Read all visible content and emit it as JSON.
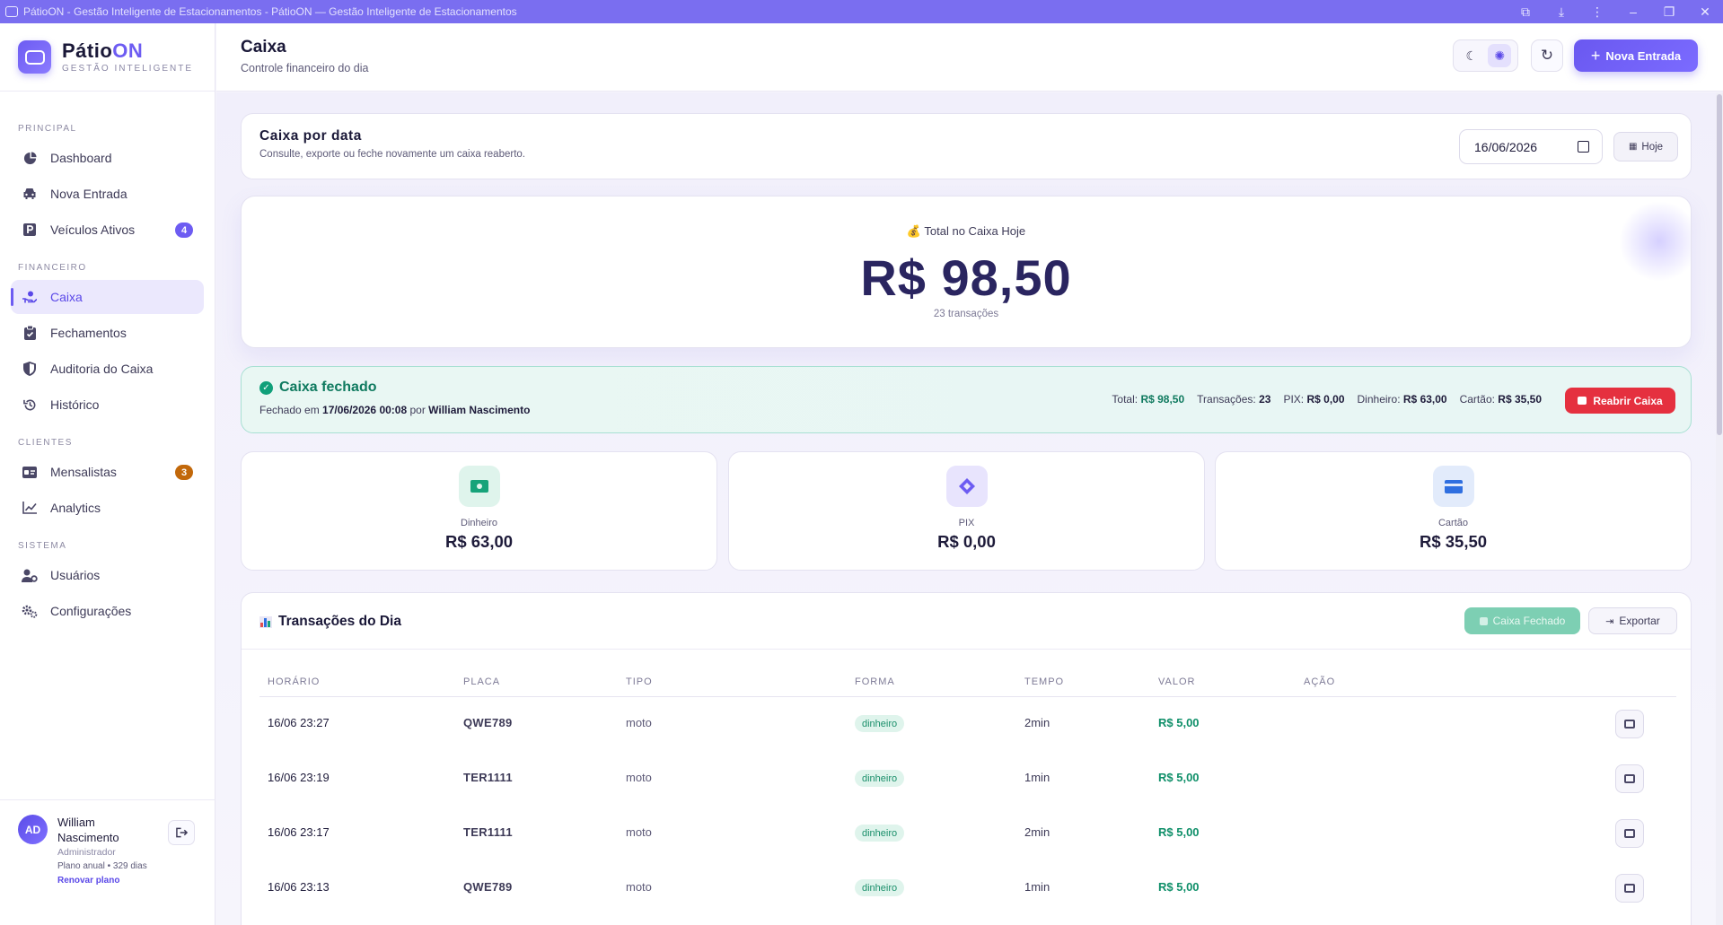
{
  "window": {
    "title": "PátioON - Gestão Inteligente de Estacionamentos - PátioON — Gestão Inteligente de Estacionamentos"
  },
  "brand": {
    "name_a": "Pátio",
    "name_b": "ON",
    "tagline": "GESTÃO INTELIGENTE"
  },
  "sidebar": {
    "sections": [
      "PRINCIPAL",
      "FINANCEIRO",
      "CLIENTES",
      "SISTEMA"
    ],
    "items": [
      {
        "label": "Dashboard",
        "icon": "dashboard-icon"
      },
      {
        "label": "Nova Entrada",
        "icon": "car-icon"
      },
      {
        "label": "Veículos Ativos",
        "icon": "parking-icon",
        "badge": "4"
      },
      {
        "label": "Caixa",
        "icon": "cash-hand-icon",
        "active": true
      },
      {
        "label": "Fechamentos",
        "icon": "clipboard-icon"
      },
      {
        "label": "Auditoria do Caixa",
        "icon": "shield-icon"
      },
      {
        "label": "Histórico",
        "icon": "history-icon"
      },
      {
        "label": "Mensalistas",
        "icon": "id-card-icon",
        "badge": "3"
      },
      {
        "label": "Analytics",
        "icon": "chart-line-icon"
      },
      {
        "label": "Usuários",
        "icon": "user-gear-icon"
      },
      {
        "label": "Configurações",
        "icon": "gears-icon"
      }
    ],
    "user": {
      "initials": "AD",
      "name": "William Nascimento",
      "role": "Administrador",
      "plan": "Plano anual • 329 dias",
      "renew": "Renovar plano"
    }
  },
  "header": {
    "title": "Caixa",
    "subtitle": "Controle financeiro do dia",
    "new_entry": "Nova Entrada"
  },
  "date_panel": {
    "title": "Caixa por data",
    "subtitle": "Consulte, exporte ou feche novamente um caixa reaberto.",
    "date_value": "16/06/2026",
    "today_label": "Hoje"
  },
  "total": {
    "label": "💰 Total no Caixa Hoje",
    "value": "R$ 98,50",
    "count": "23 transações"
  },
  "closed": {
    "title": "Caixa fechado",
    "closed_prefix": "Fechado em",
    "closed_at": "17/06/2026 00:08",
    "by_prefix": "por",
    "by": "William Nascimento",
    "stats": {
      "total_k": "Total:",
      "total_v": "R$ 98,50",
      "tx_k": "Transações:",
      "tx_v": "23",
      "pix_k": "PIX:",
      "pix_v": "R$ 0,00",
      "cash_k": "Dinheiro:",
      "cash_v": "R$ 63,00",
      "card_k": "Cartão:",
      "card_v": "R$ 35,50"
    },
    "reopen": "Reabrir Caixa"
  },
  "payments": [
    {
      "label": "Dinheiro",
      "value": "R$ 63,00",
      "icon": "money-icon",
      "color": "#17a37a",
      "bg": "#dff4ec"
    },
    {
      "label": "PIX",
      "value": "R$ 0,00",
      "icon": "pix-icon",
      "color": "#6d5cf2",
      "bg": "#e8e4fd"
    },
    {
      "label": "Cartão",
      "value": "R$ 35,50",
      "icon": "credit-card-icon",
      "color": "#2f6fe0",
      "bg": "#e2ebfb"
    }
  ],
  "transactions": {
    "title": "Transações do Dia",
    "closed_btn": "Caixa Fechado",
    "export_btn": "Exportar",
    "columns": [
      "HORÁRIO",
      "PLACA",
      "TIPO",
      "FORMA",
      "TEMPO",
      "VALOR",
      "AÇÃO"
    ],
    "rows": [
      {
        "time": "16/06 23:27",
        "plate": "QWE789",
        "type": "moto",
        "method": "dinheiro",
        "duration": "2min",
        "value": "R$ 5,00"
      },
      {
        "time": "16/06 23:19",
        "plate": "TER1111",
        "type": "moto",
        "method": "dinheiro",
        "duration": "1min",
        "value": "R$ 5,00"
      },
      {
        "time": "16/06 23:17",
        "plate": "TER1111",
        "type": "moto",
        "method": "dinheiro",
        "duration": "2min",
        "value": "R$ 5,00"
      },
      {
        "time": "16/06 23:13",
        "plate": "QWE789",
        "type": "moto",
        "method": "dinheiro",
        "duration": "1min",
        "value": "R$ 5,00"
      }
    ]
  },
  "colors": {
    "accent": "#6d5cf2",
    "success": "#0f8f69",
    "danger": "#e5303f",
    "badge_purple": "#6d5cf2",
    "badge_orange": "#c2680a"
  }
}
